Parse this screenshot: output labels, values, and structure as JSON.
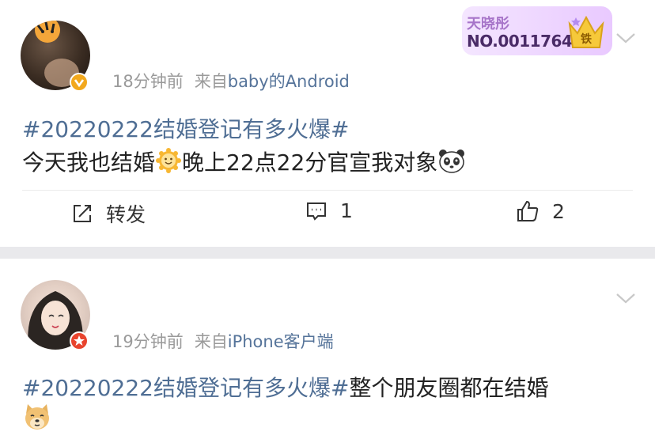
{
  "post1": {
    "meta_time": "18分钟前",
    "meta_from": "来自",
    "meta_device": "baby的Android",
    "hashtag": "#20220222结婚登记有多火爆#",
    "text_a": "今天我也结婚",
    "text_b": "晚上22点22分官宣我对象",
    "fan_badge_title": "天晓彤",
    "fan_badge_no": "NO.0011764",
    "fan_badge_icon": "铁",
    "repost_label": "转发",
    "comment_count": "1",
    "like_count": "2"
  },
  "post2": {
    "meta_time": "19分钟前",
    "meta_from": "来自",
    "meta_device": "iPhone客户端",
    "hashtag": "#20220222结婚登记有多火爆#",
    "text": "整个朋友圈都在结婚"
  },
  "colors": {
    "link_blue": "#4f6e94",
    "verified_gold": "#f2a81d",
    "verified_red": "#e8442e",
    "meta_gray": "#9a9a9a",
    "page_bg": "#e9e9ec"
  }
}
